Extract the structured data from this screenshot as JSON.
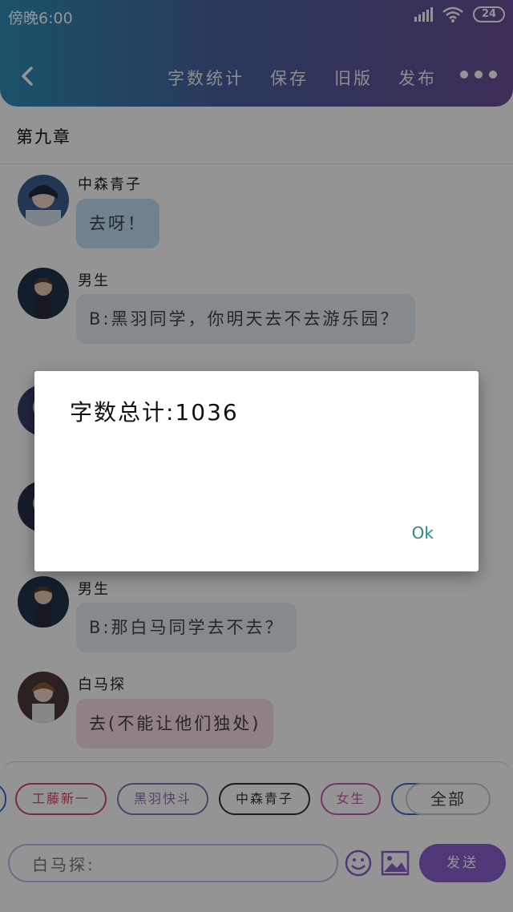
{
  "status_bar": {
    "time": "傍晚6:00",
    "battery": "24"
  },
  "toolbar": {
    "actions": [
      "字数统计",
      "保存",
      "旧版",
      "发布"
    ]
  },
  "chapter": {
    "title": "第九章"
  },
  "messages": [
    {
      "speaker": "中森青子",
      "text": "去呀！",
      "bubble_color": "#bfe1f5"
    },
    {
      "speaker": "男生",
      "text": "B:黑羽同学，你明天去不去游乐园？",
      "bubble_color": "#e6eef5"
    },
    {
      "speaker": "男生",
      "text": "B:那白马同学去不去？",
      "bubble_color": "#e6eef5"
    },
    {
      "speaker": "白马探",
      "text": "去(不能让他们独处)",
      "bubble_color": "#f6dfe6"
    }
  ],
  "characters": [
    {
      "label": "工藤新一",
      "color": "#d24b62"
    },
    {
      "label": "黑羽快斗",
      "color": "#8e6fbf"
    },
    {
      "label": "中森青子",
      "color": "#333333"
    },
    {
      "label": "女生",
      "color": "#c95bb4"
    },
    {
      "label": "全部",
      "color": "#999999"
    }
  ],
  "input": {
    "value": "白马探:"
  },
  "send_label": "发送",
  "dialog": {
    "message": "字数总计:1036",
    "ok_label": "Ok"
  }
}
